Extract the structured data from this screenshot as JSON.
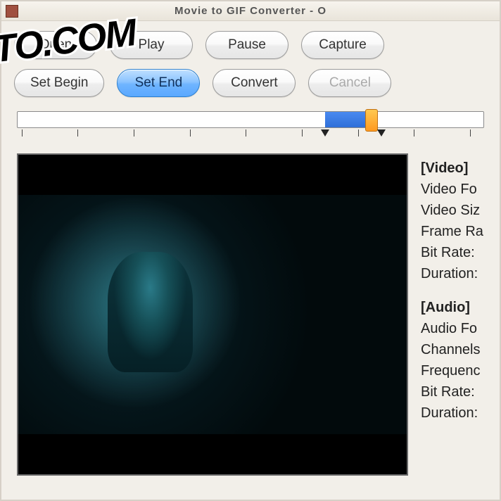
{
  "window": {
    "title": "Movie to GIF Converter - O"
  },
  "buttons": {
    "open": "Open",
    "play": "Play",
    "pause": "Pause",
    "capture": "Capture",
    "set_begin": "Set Begin",
    "set_end": "Set End",
    "convert": "Convert",
    "cancel": "Cancel"
  },
  "slider": {
    "value_percent": 76,
    "fill_start_percent": 66,
    "fill_width_percent": 10,
    "marker_begin_percent": 66,
    "marker_end_percent": 78,
    "ticks": [
      1,
      13,
      25,
      37,
      49,
      61,
      73,
      85,
      97
    ]
  },
  "info": {
    "video": {
      "heading": "[Video]",
      "lines": [
        "Video Fo",
        "Video Siz",
        "Frame Ra",
        "Bit Rate:",
        "Duration:"
      ]
    },
    "audio": {
      "heading": "[Audio]",
      "lines": [
        "Audio Fo",
        "Channels",
        "Frequenc",
        "Bit Rate:",
        "Duration:"
      ]
    }
  },
  "watermark": "XIFTO.COM"
}
